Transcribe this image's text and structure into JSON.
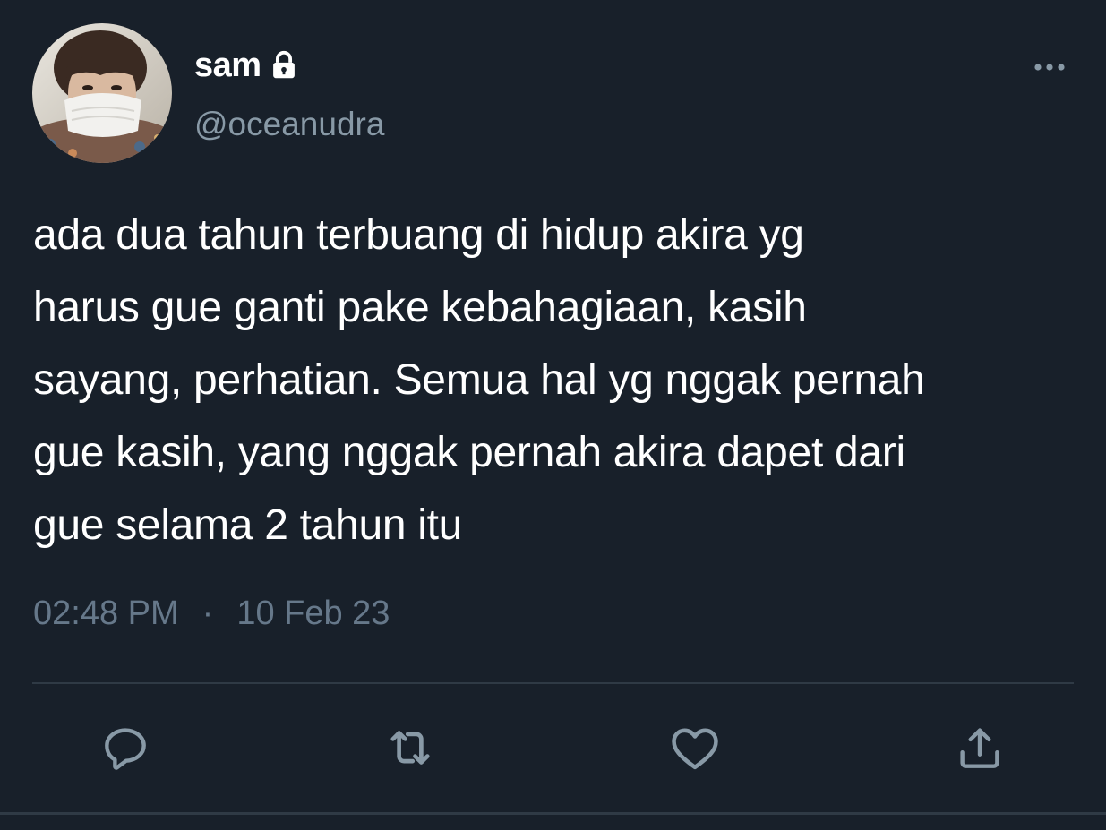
{
  "user": {
    "display_name": "sam",
    "handle": "@oceanudra",
    "avatar_icon": "avatar-photo",
    "protected_icon": "lock-icon"
  },
  "tweet": {
    "text": "ada dua tahun terbuang di hidup akira yg\nharus gue ganti pake kebahagiaan, kasih\nsayang, perhatian. Semua hal yg nggak pernah\ngue kasih, yang nggak pernah akira dapet dari\ngue selama 2 tahun itu",
    "time": "02:48 PM",
    "separator": "·",
    "date": "10 Feb 23"
  },
  "actions": [
    {
      "name": "reply",
      "icon": "reply-icon"
    },
    {
      "name": "retweet",
      "icon": "retweet-icon"
    },
    {
      "name": "like",
      "icon": "heart-icon"
    },
    {
      "name": "share",
      "icon": "share-icon"
    }
  ],
  "colors": {
    "background": "#18202a",
    "text_primary": "#ffffff",
    "text_secondary": "#8899a6",
    "meta": "#66788a",
    "icon": "#8899a6",
    "divider": "#2f3a45"
  }
}
